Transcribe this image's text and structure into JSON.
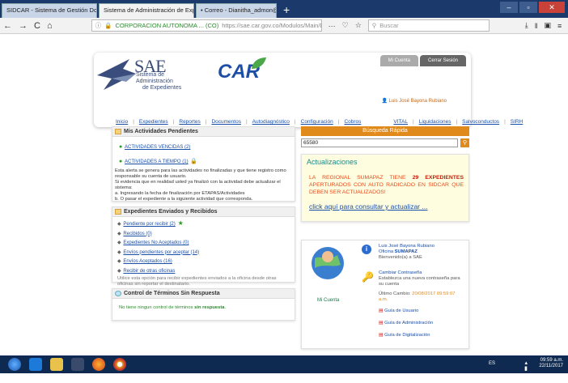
{
  "browser": {
    "tabs": [
      {
        "label": "SIDCAR - Sistema de Gestión Docu",
        "active": false
      },
      {
        "label": "Sistema de Administración de Exp",
        "active": true
      },
      {
        "label": "• Correo - Dianitha_admon@ho",
        "active": false
      }
    ],
    "new_tab": "+",
    "url_site": "CORPORACION AUTONOMA ... (CO)",
    "url": "https://sae.car.gov.co/Modulos/Main/Default.as",
    "search_placeholder": "Buscar",
    "nav": {
      "back": "←",
      "forward": "→",
      "reload": "C",
      "home": "⌂",
      "more": "···"
    }
  },
  "header": {
    "sae": "SAE",
    "sae_sub1": "Sistema de Administración",
    "sae_sub2": "de Expedientes",
    "car": "CAR",
    "tab_account": "Mi Cuenta",
    "tab_logout": "Cerrar Sesión",
    "user": "Luis José Bayona Rubiano",
    "menu": [
      "Inicio",
      "Expedientes",
      "Reportes",
      "Documentos",
      "Autodiagnóstico",
      "Configuración",
      "Cobros",
      "VITAL",
      "Liquidaciones",
      "Salvoconductos",
      "SIRH"
    ]
  },
  "pending": {
    "title": "Mis Actividades Pendientes",
    "link1": "ACTIVIDADES VENCIDAS (2)",
    "link2": "ACTIVIDADES A TIEMPO (1)",
    "text": [
      "Esta alerta se genera para las actividades no finalizadas y que tiene registro como",
      "responsable su cuenta de usuario.",
      "Si evidencia que en realidad usted ya finalizó con la actividad debe actualizar el sistema:",
      "a. Ingresando la fecha de finalización por ETAPAS/Actividades",
      "b. O pasar el expediente a la siguiente actividad que corresponda."
    ]
  },
  "sent": {
    "title": "Expedientes Enviados y Recibidos",
    "links": [
      "Pendiente por recibir (2)",
      "Recibidos (0)",
      "Expedientes No Aceptados (0)",
      "Envíos pendientes por aceptar (14)",
      "Envíos Aceptados (16)",
      "Recibir de otras oficinas"
    ],
    "note": "Utilice esta opción para recibir expedientes enviados a la oficina desde otras oficinas sin reportar el destinatario."
  },
  "control": {
    "title": "Control de Términos Sin Respuesta",
    "text": "No tiene ningun control de términos",
    "bold": "sin respuesta"
  },
  "quick": {
    "title": "Búsqueda Rápida",
    "value": "65580",
    "button": "⚲"
  },
  "updates": {
    "title": "Actualizaciones",
    "line1a": "LA REGIONAL SUMAPAZ TIENE",
    "count": "29 EXPEDIENTES",
    "line2": "APERTURADOS CON AUTO RADICADO EN SIDCAR QUE DEBEN SER ACTUALIZADOS!",
    "link": "click aquí para consultar y actualizar ..."
  },
  "account": {
    "label": "Mi Cuenta",
    "name": "Luis José Bayona Rubiano",
    "office_label": "Oficina",
    "office": "SUMAPAZ",
    "welcome": "Bienvenido(a) a SAE",
    "change_pw": "Cambiar Contraseña",
    "change_pw_desc": "Establezca una nueva contraseña para su cuenta",
    "last_change_label": "Último Cambio:",
    "last_change": "20/08/2017 09:59:07 a.m.",
    "guides": [
      "Guía de Usuario",
      "Guía de Administración",
      "Guía de Digitalización"
    ]
  },
  "taskbar": {
    "lang": "ES",
    "time": "09:59 a.m.",
    "date": "22/11/2017"
  }
}
